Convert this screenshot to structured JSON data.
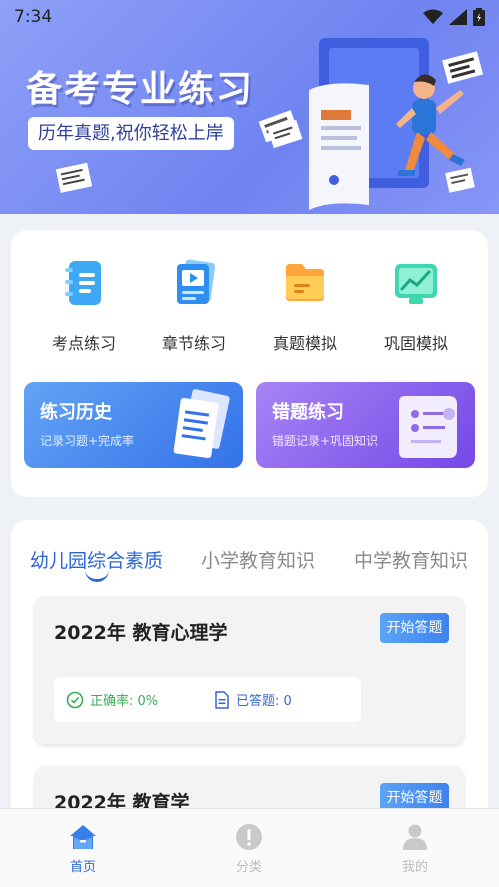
{
  "status_bar": {
    "time": "7:34"
  },
  "banner": {
    "title": "备考专业练习",
    "subtitle": "历年真题,祝你轻松上岸"
  },
  "quick_links": [
    {
      "label": "考点练习",
      "icon": "notebook-icon"
    },
    {
      "label": "章节练习",
      "icon": "video-lesson-icon"
    },
    {
      "label": "真题模拟",
      "icon": "folder-icon"
    },
    {
      "label": "巩固模拟",
      "icon": "chart-icon"
    }
  ],
  "promos": [
    {
      "title": "练习历史",
      "subtitle": "记录习题+完成率"
    },
    {
      "title": "错题练习",
      "subtitle": "错题记录+巩固知识"
    }
  ],
  "tabs": [
    "幼儿园综合素质",
    "小学教育知识",
    "中学教育知识"
  ],
  "exams": [
    {
      "title": "2022年 教育心理学",
      "button": "开始答题",
      "accuracy": "正确率: 0%",
      "answered": "已答题: 0"
    },
    {
      "title": "2022年 教育学",
      "button": "开始答题"
    }
  ],
  "nav": [
    {
      "label": "首页",
      "icon": "home-icon"
    },
    {
      "label": "分类",
      "icon": "category-icon"
    },
    {
      "label": "我的",
      "icon": "profile-icon"
    }
  ],
  "colors": {
    "accent": "#2b67d8",
    "banner": "#7b8ef3",
    "success": "#3aaa55"
  }
}
